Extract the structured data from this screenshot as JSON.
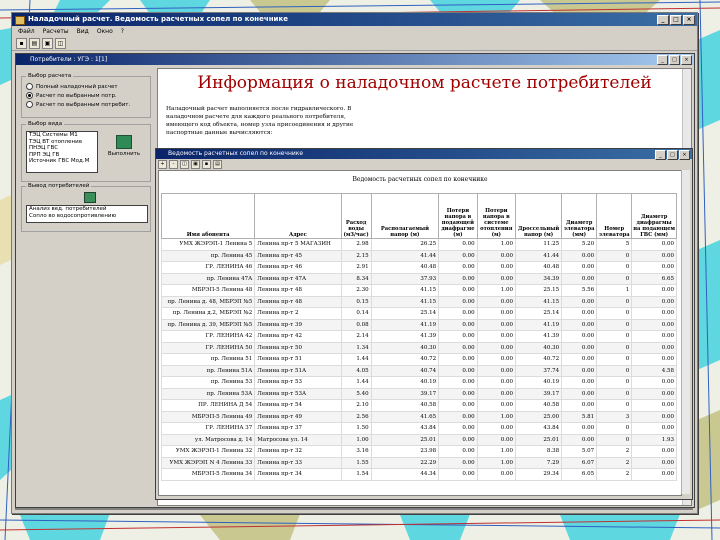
{
  "app": {
    "title": "Наладочный расчет. Ведомость расчетных сопел по конечнике",
    "menu": [
      "Файл",
      "Расчеты",
      "Вид",
      "Окно",
      "?"
    ],
    "inner_title": "Потребители : УГЭ : 1[1]"
  },
  "left": {
    "group1_caption": "Выбор расчета",
    "radios": [
      {
        "label": "Полный наладочный расчет",
        "checked": false
      },
      {
        "label": "Расчет по выбранным потр.",
        "checked": true
      },
      {
        "label": "Расчет по выбранным потребит.",
        "checked": false
      }
    ],
    "group2_caption": "Выбор вида",
    "list_items": [
      "ТЭЦ Системы М1",
      "ТЭЦ ВТ отопление",
      "ПНЭЦ ГВС",
      "ПРП ЭЦ ГВ",
      "Источник ГВС Мод.М"
    ],
    "button_label": "Выполнить",
    "group3_caption": "Вывод потребителей",
    "output_items": [
      "Анализ вед. потребителей",
      "Сопло во водосопротивлению"
    ]
  },
  "doc": {
    "heading": "Информация о наладочном расчете потребителей",
    "intro": "Наладочный расчет выполняется после гидравлического. В наладочном расчете для каждого реального потребителя, имеющего код объекта, номер узла присоединения и другие паспортные данные вычисляются:"
  },
  "report": {
    "title": "Ведомость расчетных сопел по конечнике",
    "heading": "Ведомость расчетных сопел по конечнике",
    "columns": [
      "Имя абонента",
      "Адрес",
      "Расход воды (м3/час)",
      "Располагаемый напор (м)",
      "Потери напора в подающей диафрагме (м)",
      "Потери напора в системе отопления (м)",
      "Дроссельный напор (м)",
      "Диаметр элеватора (мм)",
      "Номер элеватора",
      "Диаметр диафрагмы на подающем ГВС (мм)"
    ],
    "rows": [
      [
        "УМХ ЖЭРЭП-1 Ленина 5",
        "Ленина пр-т 5 МАГАЗИН",
        "2.98",
        "26.25",
        "0.00",
        "1.00",
        "11.25",
        "5.20",
        "5",
        "0.00"
      ],
      [
        "пр. Ленина 45",
        "Ленина пр-т 45",
        "2.15",
        "41.44",
        "0.00",
        "0.00",
        "41.44",
        "0.00",
        "0",
        "0.00"
      ],
      [
        "ГР. ЛЕНИНА 46",
        "Ленина пр-т 46",
        "2.91",
        "40.48",
        "0.00",
        "0.00",
        "40.48",
        "0.00",
        "0",
        "0.00"
      ],
      [
        "пр. Ленина 47А",
        "Ленина пр-т 47А",
        "8.34",
        "37.93",
        "0.00",
        "0.00",
        "34.39",
        "0.00",
        "0",
        "6.65"
      ],
      [
        "МБРЭП-5 Ленина 48",
        "Ленина пр-т 48",
        "2.30",
        "41.15",
        "0.00",
        "1.00",
        "25.15",
        "5.56",
        "1",
        "0.00"
      ],
      [
        "пр. Ленина д. 48, МБРЭП №5",
        "Ленина пр-т 48",
        "0.15",
        "41.15",
        "0.00",
        "0.00",
        "41.15",
        "0.00",
        "0",
        "0.00"
      ],
      [
        "пр. Ленина д.2, МБРЭП №2",
        "Ленина пр-т 2",
        "0.14",
        "25.14",
        "0.00",
        "0.00",
        "25.14",
        "0.00",
        "0",
        "0.00"
      ],
      [
        "пр. Ленина д. 39, МБРЭП №5",
        "Ленина пр-т 39",
        "0.08",
        "41.19",
        "0.00",
        "0.00",
        "41.19",
        "0.00",
        "0",
        "0.00"
      ],
      [
        "ГР. ЛЕНИНА 42",
        "Ленина пр-т 42",
        "2.14",
        "41.39",
        "0.00",
        "0.00",
        "41.39",
        "0.00",
        "0",
        "0.00"
      ],
      [
        "ГР. ЛЕНИНА 50",
        "Ленина пр-т 50",
        "1.34",
        "40.30",
        "0.00",
        "0.00",
        "40.30",
        "0.00",
        "0",
        "0.00"
      ],
      [
        "пр. Ленина 51",
        "Ленина пр-т 51",
        "1.44",
        "40.72",
        "0.00",
        "0.00",
        "40.72",
        "0.00",
        "0",
        "0.00"
      ],
      [
        "пр. Ленина 51А",
        "Ленина пр-т 51А",
        "4.05",
        "40.74",
        "0.00",
        "0.00",
        "37.74",
        "0.00",
        "0",
        "4.58"
      ],
      [
        "пр. Ленина 53",
        "Ленина пр-т 53",
        "1.44",
        "40.19",
        "0.00",
        "0.00",
        "40.19",
        "0.00",
        "0",
        "0.00"
      ],
      [
        "пр. Ленина 53А",
        "Ленина пр-т 53А",
        "5.40",
        "39.17",
        "0.00",
        "0.00",
        "39.17",
        "0.00",
        "0",
        "0.00"
      ],
      [
        "ПР. ЛЕНИНА Д 54",
        "Ленина пр-т 54",
        "2.10",
        "40.58",
        "0.00",
        "0.00",
        "40.58",
        "0.00",
        "0",
        "0.00"
      ],
      [
        "МБРЭП-5 Ленина 49",
        "Ленина пр-т 49",
        "2.56",
        "41.65",
        "0.00",
        "1.00",
        "25.00",
        "5.81",
        "3",
        "0.00"
      ],
      [
        "ГР. ЛЕНИНА 37",
        "Ленина пр-т 37",
        "1.50",
        "43.84",
        "0.00",
        "0.00",
        "43.84",
        "0.00",
        "0",
        "0.00"
      ],
      [
        "ул. Матросова д. 14",
        "Матросова ул. 14",
        "1.00",
        "25.01",
        "0.00",
        "0.00",
        "25.01",
        "0.00",
        "0",
        "1.93"
      ],
      [
        "УМХ ЖЭРЭП-1 Ленина 32",
        "Ленина пр-т 32",
        "3.16",
        "23.98",
        "0.00",
        "1.00",
        "8.38",
        "5.07",
        "2",
        "0.00"
      ],
      [
        "УМХ ЖЭРЭП N 4 Ленина 33",
        "Ленина пр-т 33",
        "1.55",
        "22.29",
        "0.00",
        "1.00",
        "7.29",
        "6.07",
        "2",
        "0.00"
      ],
      [
        "МБРЭП-5 Ленина 34",
        "Ленина пр-т 34",
        "1.54",
        "44.34",
        "0.00",
        "0.00",
        "29.34",
        "6.05",
        "2",
        "0.00"
      ]
    ]
  },
  "colors": {
    "title_start": "#0a246a",
    "title_end": "#3a6ea5",
    "heading": "#a00000"
  },
  "icons": [
    "save-icon",
    "print-icon",
    "open-icon",
    "preview-icon",
    "close-icon",
    "minimize-icon",
    "maximize-icon"
  ]
}
